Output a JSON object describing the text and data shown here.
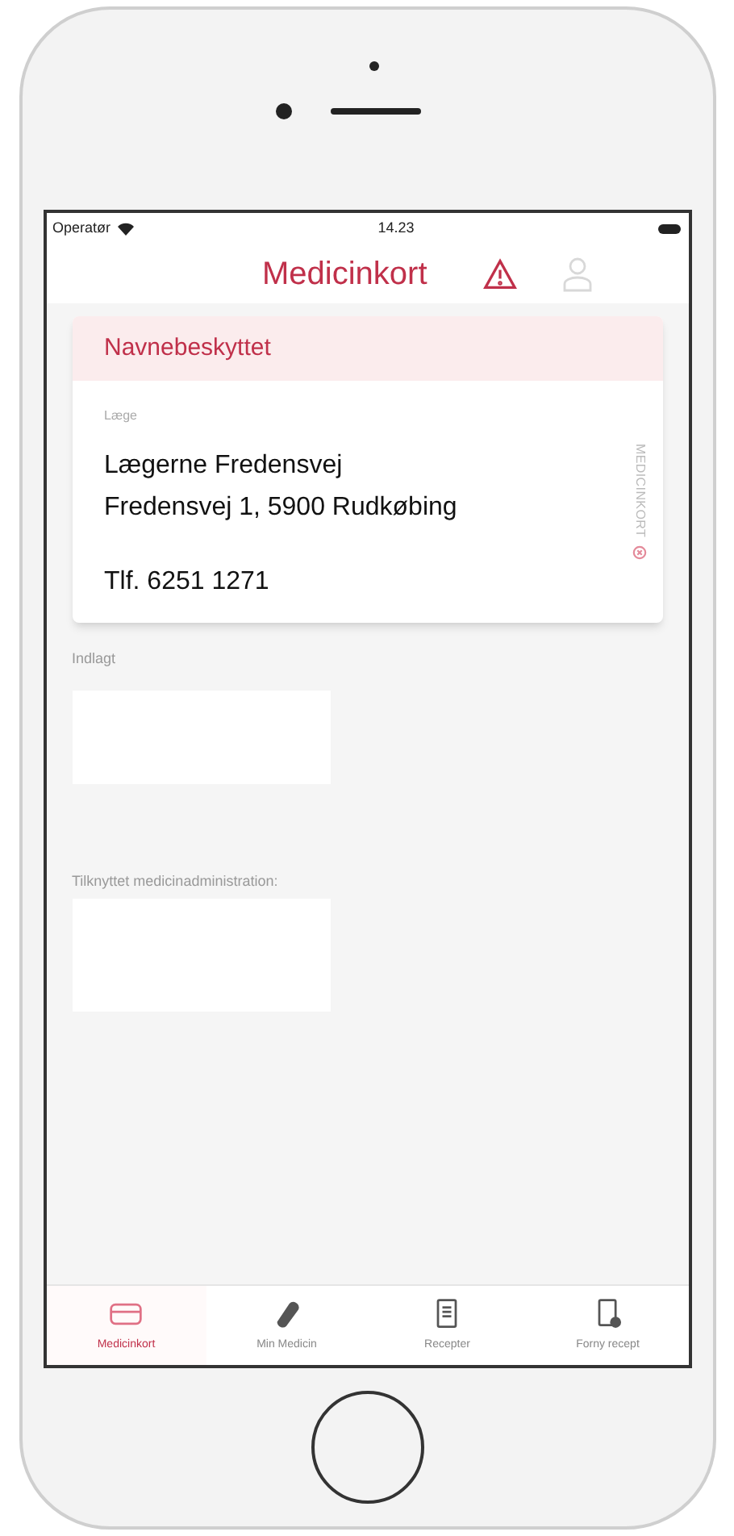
{
  "status_bar": {
    "carrier": "Operatør",
    "time": "14.23"
  },
  "header": {
    "title": "Medicinkort"
  },
  "card": {
    "title": "Navnebeskyttet",
    "field_label": "Læge",
    "lines": [
      "Lægerne Fredensvej",
      "Fredensvej 1, 5900 Rudkøbing"
    ],
    "phone": "Tlf. 6251 1271",
    "side_label": "MEDICINKORT"
  },
  "sections": [
    {
      "label": "Indlagt"
    },
    {
      "label": "Tilknyttet medicinadministration:"
    }
  ],
  "tabs": [
    {
      "label": "Medicinkort",
      "selected": true,
      "kind": "card"
    },
    {
      "label": "Min Medicin",
      "selected": false,
      "kind": "pill"
    },
    {
      "label": "Recepter",
      "selected": false,
      "kind": "document"
    },
    {
      "label": "Forny recept",
      "selected": false,
      "kind": "renew"
    }
  ]
}
